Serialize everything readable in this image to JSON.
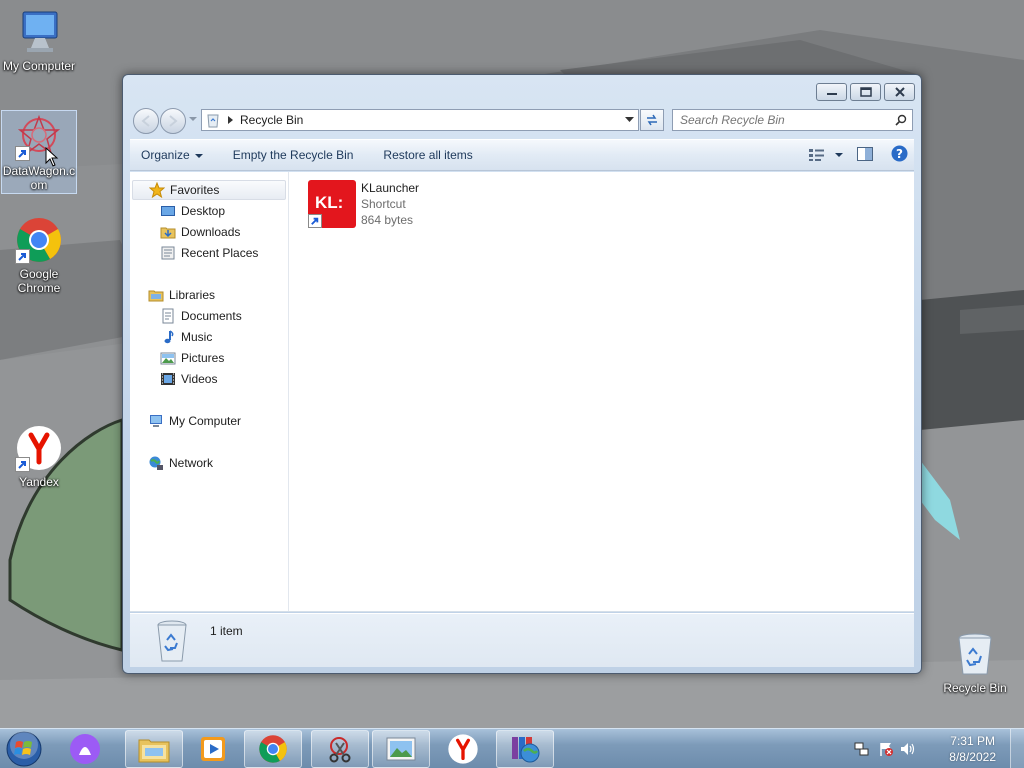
{
  "desktop": {
    "icons": [
      {
        "label": "My Computer",
        "icon": "computer-icon"
      },
      {
        "label": "DataWagon.com",
        "label_lines": [
          "DataWagon.c",
          "om"
        ],
        "icon": "datawagon-icon",
        "selected": true
      },
      {
        "label": "Google Chrome",
        "label_lines": [
          "Google",
          "Chrome"
        ],
        "icon": "chrome-icon"
      },
      {
        "label": "Yandex",
        "icon": "yandex-icon"
      },
      {
        "label": "Recycle Bin",
        "icon": "recycle-bin-icon"
      }
    ]
  },
  "window": {
    "address": "Recycle Bin",
    "search_placeholder": "Search Recycle Bin",
    "toolbar": {
      "organize": "Organize",
      "empty": "Empty the Recycle Bin",
      "restore": "Restore all items"
    },
    "nav": {
      "favorites": "Favorites",
      "desktop": "Desktop",
      "downloads": "Downloads",
      "recent": "Recent Places",
      "libraries": "Libraries",
      "documents": "Documents",
      "music": "Music",
      "pictures": "Pictures",
      "videos": "Videos",
      "computer": "My Computer",
      "network": "Network"
    },
    "files": [
      {
        "name": "KLauncher",
        "type": "Shortcut",
        "size": "864 bytes",
        "icon_text": "KL:"
      }
    ],
    "status": "1 item"
  },
  "taskbar": {
    "apps": [
      "explorer-icon",
      "media-player-icon",
      "chrome-icon",
      "snipping-tool-icon",
      "photo-viewer-icon",
      "yandex-icon",
      "winrar-icon"
    ],
    "time": "7:31 PM",
    "date": "8/8/2022"
  },
  "colors": {
    "accent": "#1e395b",
    "klauncher_red": "#e3161d",
    "taskbar": "#7d9bb9"
  }
}
